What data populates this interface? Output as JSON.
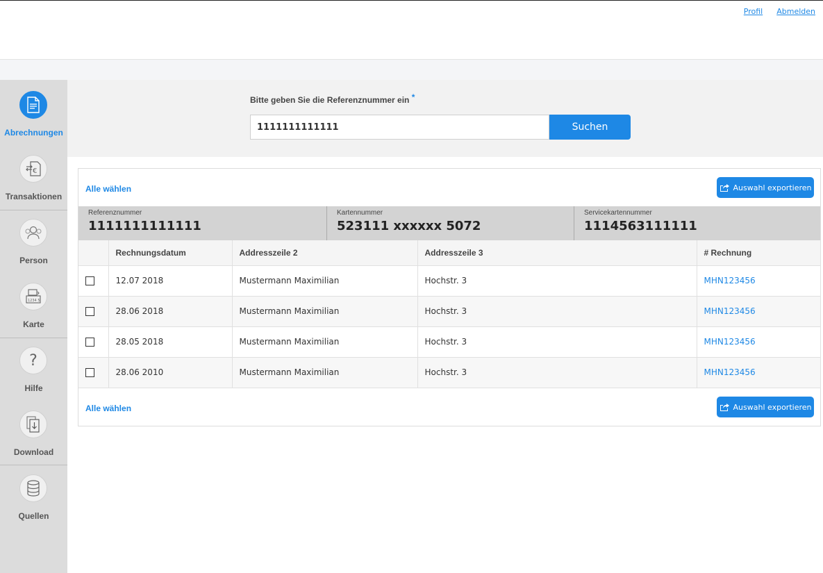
{
  "header": {
    "profile_link": "Profil",
    "logout_link": "Abmelden"
  },
  "sidebar": {
    "items": [
      {
        "label": "Abrechnungen",
        "icon": "invoice-icon",
        "active": true
      },
      {
        "label": "Transaktionen",
        "icon": "transactions-icon"
      },
      {
        "label": "Person",
        "icon": "person-icon"
      },
      {
        "label": "Karte",
        "icon": "card-icon"
      },
      {
        "label": "Hilfe",
        "icon": "help-icon"
      },
      {
        "label": "Download",
        "icon": "download-icon"
      },
      {
        "label": "Quellen",
        "icon": "database-icon"
      }
    ]
  },
  "search": {
    "label": "Bitte geben Sie die Referenznummer ein",
    "required_mark": "*",
    "value": "1111111111111",
    "button_label": "Suchen"
  },
  "results": {
    "select_all": "Alle wählen",
    "export_label": "Auswahl exportieren",
    "info": {
      "ref_label": "Referenznummer",
      "ref_value": "1111111111111",
      "card_label": "Kartennummer",
      "card_value": "523111 xxxxxx 5072",
      "service_label": "Servicekartennummer",
      "service_value": "1114563111111"
    },
    "columns": [
      "Rechnungsdatum",
      "Addresszeile 2",
      "Addresszeile 3",
      "# Rechnung"
    ],
    "rows": [
      {
        "date": "12.07 2018",
        "addr2": "Mustermann Maximilian",
        "addr3": "Hochstr. 3",
        "invoice": "MHN123456"
      },
      {
        "date": "28.06 2018",
        "addr2": "Mustermann Maximilian",
        "addr3": "Hochstr. 3",
        "invoice": "MHN123456"
      },
      {
        "date": "28.05 2018",
        "addr2": "Mustermann Maximilian",
        "addr3": "Hochstr. 3",
        "invoice": "MHN123456"
      },
      {
        "date": "28.06 2010",
        "addr2": "Mustermann Maximilian",
        "addr3": "Hochstr. 3",
        "invoice": "MHN123456"
      }
    ]
  },
  "colors": {
    "accent": "#1e88e5",
    "sidebar_bg": "#dcdcdc",
    "info_band_bg": "#d3d3d3"
  }
}
